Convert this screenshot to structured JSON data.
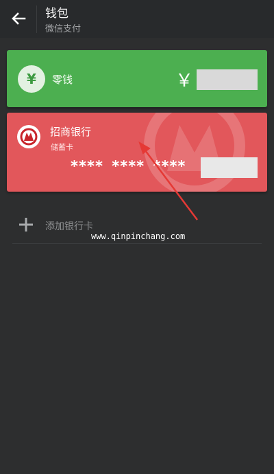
{
  "header": {
    "title": "钱包",
    "subtitle": "微信支付",
    "back_icon": "arrow-left-icon"
  },
  "change_card": {
    "icon_glyph": "¥",
    "label": "零钱",
    "currency_symbol": "￥",
    "color": "#4caf50"
  },
  "bank_card": {
    "bank_name": "招商银行",
    "card_type": "储蓄卡",
    "masked_number": "**** **** ****",
    "color": "#e2575b"
  },
  "add_card": {
    "label": "添加银行卡"
  },
  "overlay": {
    "website": "www.qinpinchang.com",
    "arrow_color": "#e53935"
  }
}
